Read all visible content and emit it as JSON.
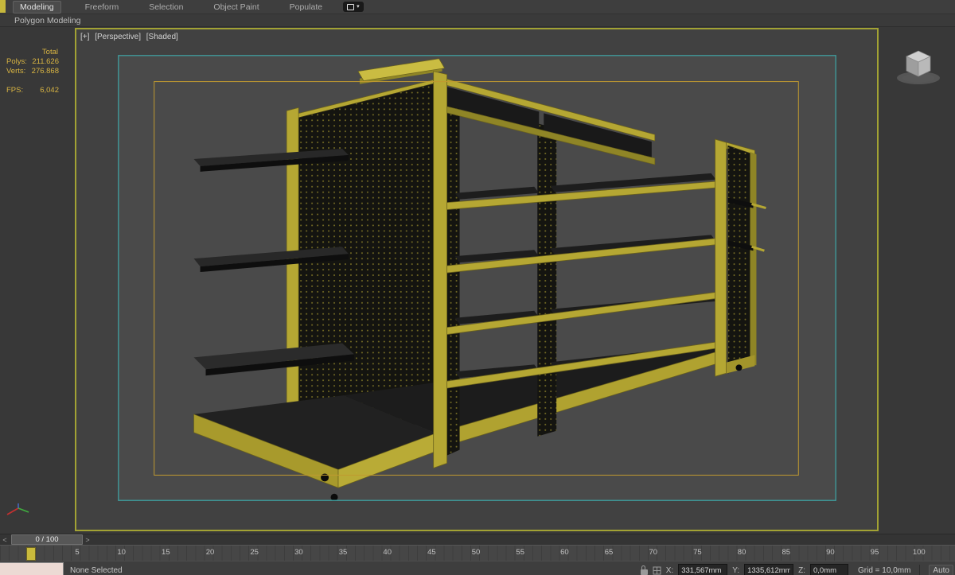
{
  "ribbon": {
    "tabs": [
      {
        "label": "Modeling",
        "active": true
      },
      {
        "label": "Freeform",
        "active": false
      },
      {
        "label": "Selection",
        "active": false
      },
      {
        "label": "Object Paint",
        "active": false
      },
      {
        "label": "Populate",
        "active": false
      }
    ],
    "panel_row_label": "Polygon Modeling"
  },
  "viewport": {
    "label_parts": [
      "[+]",
      "[Perspective]",
      "[Shaded]"
    ],
    "stats": {
      "header": "Total",
      "rows": [
        {
          "label": "Polys:",
          "value": "211.626"
        },
        {
          "label": "Verts:",
          "value": "276.868"
        }
      ],
      "fps_label": "FPS:",
      "fps_value": "6,042"
    }
  },
  "timeline": {
    "prev_arrow": "<",
    "next_arrow": ">",
    "handle_label": "0 / 100",
    "ticks": [
      "5",
      "10",
      "15",
      "20",
      "25",
      "30",
      "35",
      "40",
      "45",
      "50",
      "55",
      "60",
      "65",
      "70",
      "75",
      "80",
      "85",
      "90",
      "95",
      "100"
    ]
  },
  "statusbar": {
    "selection_status": "None Selected",
    "x_label": "X:",
    "x_value": "331,567mm",
    "y_label": "Y:",
    "y_value": "1335,612mm",
    "z_label": "Z:",
    "z_value": "0,0mm",
    "grid_info": "Grid = 10,0mm",
    "autokey_label": "Auto"
  },
  "colors": {
    "shelf_yellow": "#b5a733",
    "viewport_border": "#a2a234",
    "safe_frame_teal": "#3f9fa0",
    "safe_frame_orange": "#c09a30",
    "stats_text": "#d9b542"
  }
}
